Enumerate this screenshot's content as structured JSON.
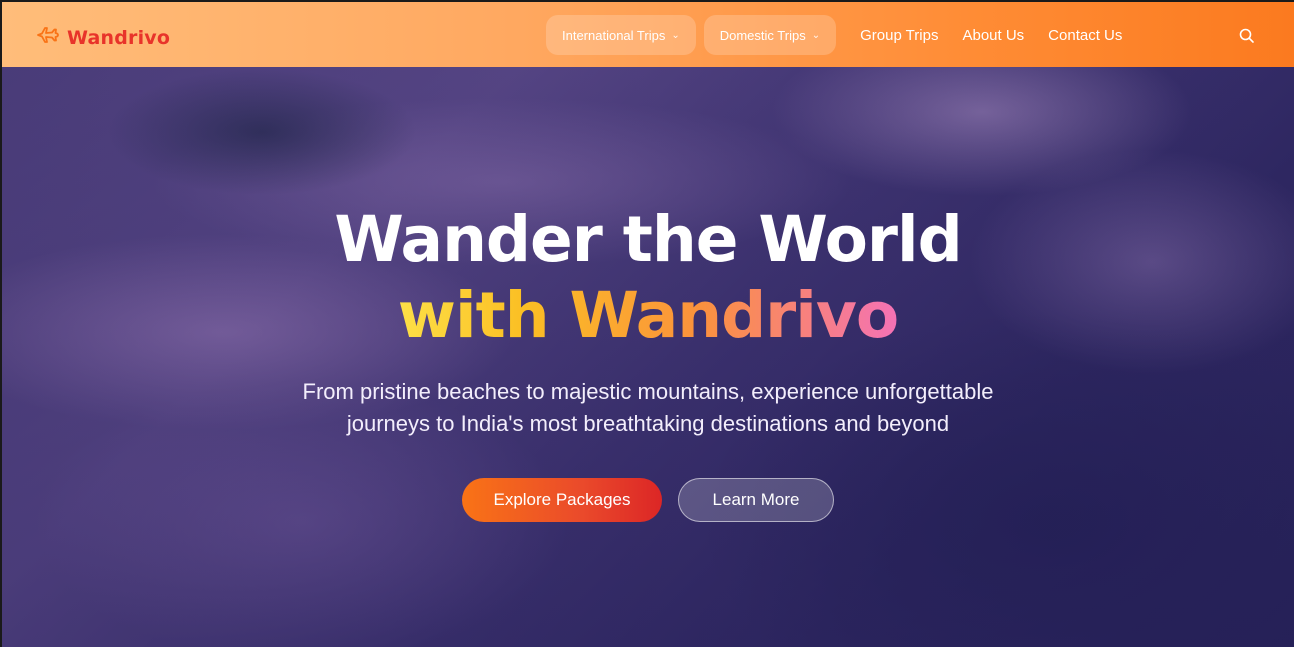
{
  "brand": {
    "name": "Wandrivo"
  },
  "nav": {
    "pills": [
      {
        "label": "International Trips"
      },
      {
        "label": "Domestic Trips"
      }
    ],
    "links": [
      {
        "label": "Group Trips"
      },
      {
        "label": "About Us"
      },
      {
        "label": "Contact Us"
      }
    ]
  },
  "hero": {
    "title_line1": "Wander the World",
    "title_line2": "with Wandrivo",
    "subtitle": "From pristine beaches to majestic mountains, experience unforgettable journeys to India's most breathtaking destinations and beyond",
    "primary_cta": "Explore Packages",
    "secondary_cta": "Learn More"
  },
  "icons": {
    "logo": "plane-icon",
    "search": "search-icon",
    "dropdown": "chevron-down-icon"
  },
  "colors": {
    "brand_text": "#e8332a",
    "nav_gradient_start": "#ffbd7a",
    "nav_gradient_end": "#fb7a1f",
    "primary_button": "#f97316",
    "accent_gradient": [
      "#fde047",
      "#fb923c",
      "#f472b6"
    ]
  }
}
